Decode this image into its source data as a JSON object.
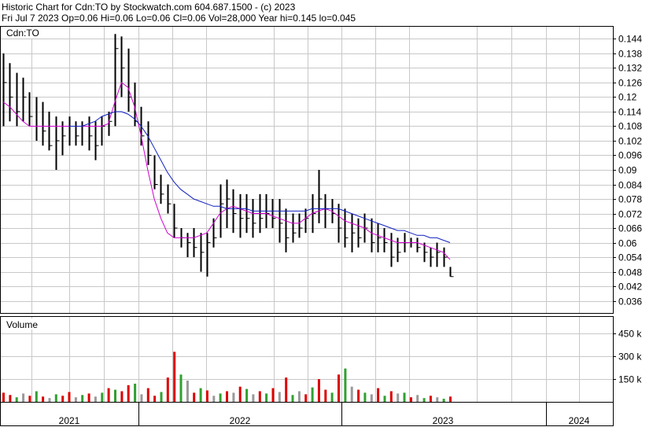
{
  "header": {
    "line1": "Historic Chart for Cdn:TO by Stockwatch.com 604.687.1500 - (c) 2023",
    "line2": "Fri Jul  7 2023   Op=0.06  Hi=0.06  Lo=0.06  Cl=0.06  Vol=28,000   Year hi=0.145   lo=0.045"
  },
  "chart_data": [
    {
      "type": "line",
      "panel": "price",
      "title": "Cdn:TO",
      "ylim": [
        0.031,
        0.149
      ],
      "y_ticks": [
        "0.144",
        "0.138",
        "0.132",
        "0.126",
        "0.12",
        "0.114",
        "0.108",
        "0.102",
        "0.096",
        "0.09",
        "0.084",
        "0.078",
        "0.072",
        "0.066",
        "0.06",
        "0.054",
        "0.048",
        "0.042",
        "0.036"
      ],
      "x_labels": [
        "2021",
        "2022",
        "2023",
        "2024"
      ],
      "grid": true,
      "colors": {
        "bar": "#000000",
        "bar_up": "#000000",
        "no_trade": "#dd0000",
        "ma_short": "#d000d0",
        "ma_long": "#1020c0"
      },
      "bars": [
        [
          0.138,
          0.108,
          0.126
        ],
        [
          0.134,
          0.11,
          0.12
        ],
        [
          0.13,
          0.108,
          0.114
        ],
        [
          0.128,
          0.11,
          0.12
        ],
        [
          0.122,
          0.108,
          0.112
        ],
        [
          0.12,
          0.102,
          0.108
        ],
        [
          0.118,
          0.1,
          0.106
        ],
        [
          0.114,
          0.098,
          0.1
        ],
        [
          0.112,
          0.09,
          0.102
        ],
        [
          0.11,
          0.096,
          0.104
        ],
        [
          0.112,
          0.1,
          0.108
        ],
        [
          0.11,
          0.1,
          0.104
        ],
        [
          0.11,
          0.1,
          0.108
        ],
        [
          0.112,
          0.098,
          0.104
        ],
        [
          0.11,
          0.094,
          0.1
        ],
        [
          0.112,
          0.1,
          0.108
        ],
        [
          0.114,
          0.104,
          0.11
        ],
        [
          0.146,
          0.108,
          0.14
        ],
        [
          0.145,
          0.12,
          0.132
        ],
        [
          0.14,
          0.114,
          0.12
        ],
        [
          0.126,
          0.108,
          0.11
        ],
        [
          0.116,
          0.1,
          0.104
        ],
        [
          0.11,
          0.092,
          0.096
        ],
        [
          0.096,
          0.082,
          0.084
        ],
        [
          0.088,
          0.076,
          0.08
        ],
        [
          0.084,
          0.072,
          0.076
        ],
        [
          0.076,
          0.062,
          0.066
        ],
        [
          0.066,
          0.058,
          0.062
        ],
        [
          0.064,
          0.054,
          0.06
        ],
        [
          0.066,
          0.054,
          0.058
        ],
        [
          0.064,
          0.048,
          0.056
        ],
        [
          0.064,
          0.046,
          0.06
        ],
        [
          0.07,
          0.058,
          0.062
        ],
        [
          0.084,
          0.062,
          0.076
        ],
        [
          0.086,
          0.066,
          0.078
        ],
        [
          0.082,
          0.064,
          0.072
        ],
        [
          0.08,
          0.062,
          0.07
        ],
        [
          0.08,
          0.064,
          0.07
        ],
        [
          0.078,
          0.062,
          0.068
        ],
        [
          0.08,
          0.064,
          0.07
        ],
        [
          0.08,
          0.066,
          0.072
        ],
        [
          0.078,
          0.066,
          0.07
        ],
        [
          0.078,
          0.06,
          0.068
        ],
        [
          0.074,
          0.056,
          0.062
        ],
        [
          0.072,
          0.06,
          0.064
        ],
        [
          0.072,
          0.062,
          0.066
        ],
        [
          0.074,
          0.064,
          0.07
        ],
        [
          0.08,
          0.064,
          0.072
        ],
        [
          0.09,
          0.068,
          0.078
        ],
        [
          0.08,
          0.066,
          0.074
        ],
        [
          0.078,
          0.068,
          0.072
        ],
        [
          0.076,
          0.06,
          0.066
        ],
        [
          0.074,
          0.058,
          0.062
        ],
        [
          0.072,
          0.056,
          0.064
        ],
        [
          0.07,
          0.058,
          0.062
        ],
        [
          0.072,
          0.06,
          0.066
        ],
        [
          0.07,
          0.056,
          0.06
        ],
        [
          0.068,
          0.056,
          0.062
        ],
        [
          0.066,
          0.056,
          0.06
        ],
        [
          0.064,
          0.05,
          0.054
        ],
        [
          0.062,
          0.052,
          0.056
        ],
        [
          0.064,
          0.056,
          0.06
        ],
        [
          0.062,
          0.058,
          0.06
        ],
        [
          0.062,
          0.056,
          0.058
        ],
        [
          0.06,
          0.052,
          0.056
        ],
        [
          0.058,
          0.05,
          0.054
        ],
        [
          0.06,
          0.05,
          0.056
        ],
        [
          0.058,
          0.05,
          0.054
        ],
        [
          0.05,
          0.046,
          0.046
        ]
      ],
      "ma_short": [
        0.118,
        0.116,
        0.113,
        0.11,
        0.108,
        0.108,
        0.108,
        0.108,
        0.108,
        0.108,
        0.108,
        0.108,
        0.108,
        0.108,
        0.108,
        0.108,
        0.109,
        0.118,
        0.126,
        0.124,
        0.116,
        0.104,
        0.09,
        0.078,
        0.07,
        0.064,
        0.062,
        0.062,
        0.062,
        0.062,
        0.063,
        0.064,
        0.068,
        0.072,
        0.074,
        0.075,
        0.074,
        0.073,
        0.072,
        0.072,
        0.072,
        0.071,
        0.07,
        0.069,
        0.068,
        0.068,
        0.07,
        0.072,
        0.073,
        0.074,
        0.073,
        0.071,
        0.069,
        0.068,
        0.067,
        0.066,
        0.064,
        0.063,
        0.062,
        0.061,
        0.06,
        0.06,
        0.06,
        0.06,
        0.059,
        0.058,
        0.057,
        0.056,
        0.053
      ],
      "ma_long": [
        null,
        null,
        null,
        null,
        null,
        null,
        null,
        null,
        null,
        null,
        0.108,
        0.108,
        0.108,
        0.109,
        0.11,
        0.112,
        0.113,
        0.114,
        0.114,
        0.113,
        0.111,
        0.108,
        0.104,
        0.099,
        0.094,
        0.089,
        0.085,
        0.082,
        0.08,
        0.078,
        0.077,
        0.076,
        0.075,
        0.075,
        0.074,
        0.074,
        0.074,
        0.074,
        0.073,
        0.073,
        0.073,
        0.073,
        0.073,
        0.073,
        0.073,
        0.073,
        0.073,
        0.074,
        0.074,
        0.074,
        0.074,
        0.074,
        0.073,
        0.072,
        0.071,
        0.07,
        0.069,
        0.068,
        0.067,
        0.066,
        0.065,
        0.065,
        0.064,
        0.063,
        0.063,
        0.062,
        0.062,
        0.061,
        0.06
      ]
    },
    {
      "type": "bar",
      "panel": "volume",
      "title": "Volume",
      "ylim": [
        0,
        560
      ],
      "y_ticks": [
        "450 k",
        "300 k",
        "150 k"
      ],
      "grid": true,
      "colors": {
        "up": "#30a030",
        "down": "#dd0000",
        "flat": "#999999"
      },
      "values": [
        60,
        45,
        30,
        55,
        40,
        70,
        35,
        25,
        50,
        40,
        65,
        30,
        45,
        55,
        35,
        60,
        90,
        80,
        70,
        110,
        120,
        50,
        90,
        40,
        65,
        160,
        330,
        180,
        140,
        60,
        90,
        75,
        40,
        55,
        70,
        60,
        100,
        85,
        50,
        70,
        55,
        90,
        65,
        160,
        45,
        70,
        50,
        95,
        150,
        80,
        60,
        180,
        220,
        100,
        80,
        60,
        50,
        90,
        40,
        70,
        55,
        60,
        30,
        45,
        25,
        40,
        30,
        20,
        35
      ],
      "directions": [
        "down",
        "down",
        "up",
        "flat",
        "down",
        "up",
        "down",
        "flat",
        "up",
        "down",
        "down",
        "flat",
        "up",
        "down",
        "flat",
        "up",
        "down",
        "up",
        "down",
        "down",
        "up",
        "flat",
        "down",
        "down",
        "up",
        "down",
        "down",
        "up",
        "flat",
        "down",
        "up",
        "down",
        "flat",
        "up",
        "down",
        "flat",
        "down",
        "up",
        "flat",
        "down",
        "up",
        "down",
        "flat",
        "down",
        "up",
        "flat",
        "down",
        "up",
        "down",
        "down",
        "up",
        "down",
        "up",
        "flat",
        "down",
        "up",
        "flat",
        "down",
        "up",
        "down",
        "flat",
        "up",
        "down",
        "flat",
        "up",
        "down",
        "flat",
        "up",
        "down"
      ]
    }
  ]
}
